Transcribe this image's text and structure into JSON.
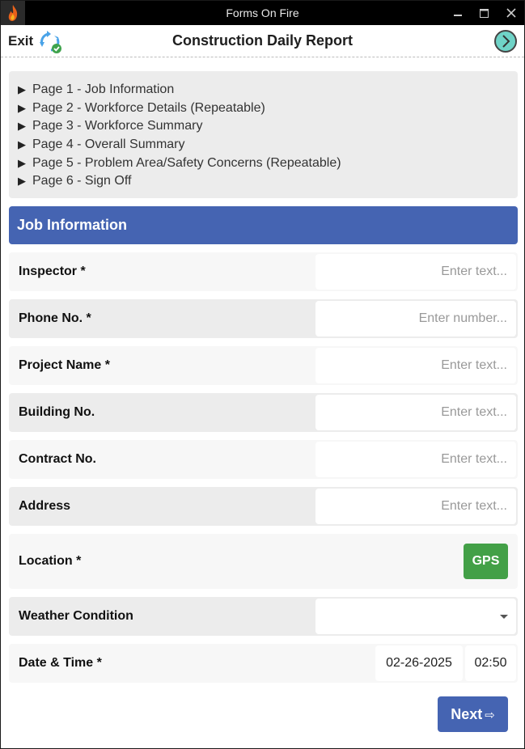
{
  "window": {
    "title": "Forms On Fire",
    "controls": {
      "minimize": "minimize",
      "maximize": "maximize",
      "close": "close"
    }
  },
  "header": {
    "exit_label": "Exit",
    "title": "Construction Daily Report",
    "icons": {
      "sync": "sync-icon",
      "forward": "chevron-right-circle-icon"
    }
  },
  "page_nav": {
    "items": [
      {
        "label": "Page 1 - Job Information"
      },
      {
        "label": "Page 2 - Workforce Details (Repeatable)"
      },
      {
        "label": "Page 3 - Workforce Summary"
      },
      {
        "label": "Page 4 - Overall Summary"
      },
      {
        "label": "Page 5 - Problem Area/Safety Concerns (Repeatable)"
      },
      {
        "label": "Page 6 - Sign Off"
      }
    ],
    "bullet": "▶"
  },
  "section": {
    "title": "Job Information"
  },
  "fields": {
    "inspector": {
      "label": "Inspector *",
      "value": "",
      "placeholder": "Enter text..."
    },
    "phone": {
      "label": "Phone No. *",
      "value": "",
      "placeholder": "Enter number..."
    },
    "project_name": {
      "label": "Project Name *",
      "value": "",
      "placeholder": "Enter text..."
    },
    "building_no": {
      "label": "Building No.",
      "value": "",
      "placeholder": "Enter text..."
    },
    "contract_no": {
      "label": "Contract No.",
      "value": "",
      "placeholder": "Enter text..."
    },
    "address": {
      "label": "Address",
      "value": "",
      "placeholder": "Enter text..."
    },
    "location": {
      "label": "Location *",
      "button_label": "GPS"
    },
    "weather": {
      "label": "Weather Condition",
      "selected": ""
    },
    "date_time": {
      "label": "Date & Time *",
      "date": "02-26-2025",
      "time": "02:50"
    }
  },
  "footer": {
    "next_label": "Next",
    "next_arrow": "⇨"
  },
  "colors": {
    "accent": "#4564b2",
    "gps": "#43a047",
    "row_light": "#f7f7f7",
    "row_dark": "#ececec",
    "forward_icon": "#6fd3c7"
  }
}
